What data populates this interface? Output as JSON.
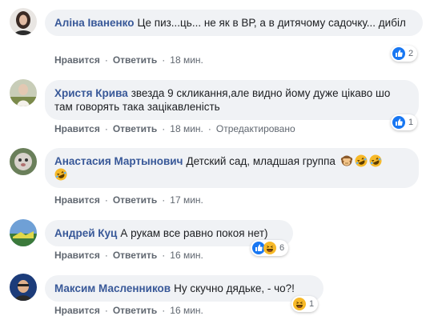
{
  "comments": [
    {
      "author": "Аліна Іваненко",
      "text": "Це пиз...ць... не як в ВР, а в дитячому садочку... дибіл",
      "actions": {
        "like": "Нравится",
        "reply": "Ответить",
        "time": "18 мин."
      },
      "reaction_icons": [
        "like-icon"
      ],
      "reaction_count": "2"
    },
    {
      "author": "Христя Крива",
      "text": "звезда 9 скликання,але видно йому дуже цікаво шо там говорять така зацікавленість",
      "actions": {
        "like": "Нравится",
        "reply": "Ответить",
        "time": "18 мин.",
        "edited": "Отредактировано"
      },
      "reaction_icons": [
        "like-icon"
      ],
      "reaction_count": "1"
    },
    {
      "author": "Анастасия Мартынович",
      "text": "Детский сад, младшая группа",
      "emojis": [
        "see-no-evil-monkey-emoji",
        "rofl-emoji",
        "rofl-emoji",
        "rofl-emoji"
      ],
      "actions": {
        "like": "Нравится",
        "reply": "Ответить",
        "time": "17 мин."
      }
    },
    {
      "author": "Андрей Куц",
      "text": "А рукам все равно покоя нет)",
      "actions": {
        "like": "Нравится",
        "reply": "Ответить",
        "time": "16 мин."
      },
      "reaction_icons": [
        "like-icon",
        "haha-icon"
      ],
      "reaction_count": "6"
    },
    {
      "author": "Максим Масленников",
      "text": "Ну скучно дядьке, - чо?!",
      "actions": {
        "like": "Нравится",
        "reply": "Ответить",
        "time": "16 мин."
      },
      "reaction_icons": [
        "haha-icon"
      ],
      "reaction_count": "1"
    }
  ],
  "colors": {
    "author": "#385898",
    "bubble": "#f0f2f5",
    "meta": "#606770",
    "like_blue": "#1877f2",
    "haha_yellow": "#f7b928"
  }
}
